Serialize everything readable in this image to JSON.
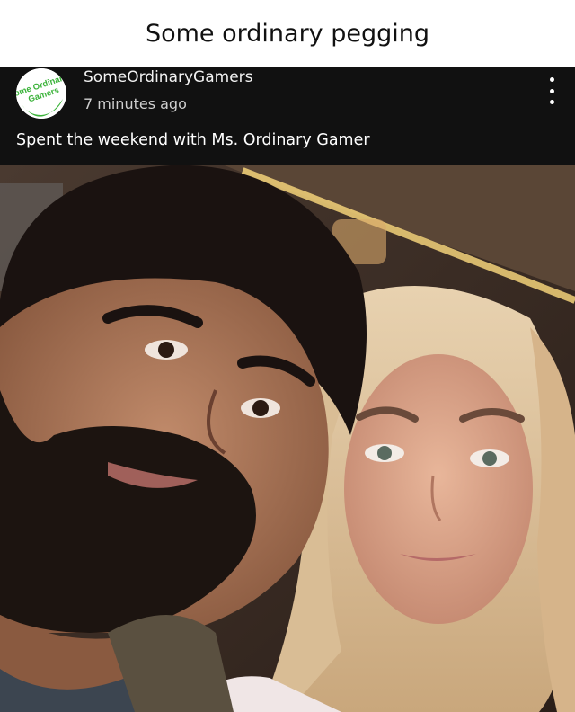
{
  "meme": {
    "title": "Some ordinary pegging"
  },
  "post": {
    "avatar_text_line1": "Some Ordinary",
    "avatar_text_line2": "Gamers",
    "username": "SomeOrdinaryGamers",
    "timestamp": "7 minutes ago",
    "caption": "Spent the weekend with Ms. Ordinary Gamer",
    "more_icon": "vertical-ellipsis-icon"
  },
  "colors": {
    "header_bg": "#111111",
    "avatar_green": "#3cb33b",
    "page_bg": "#ffffff"
  }
}
